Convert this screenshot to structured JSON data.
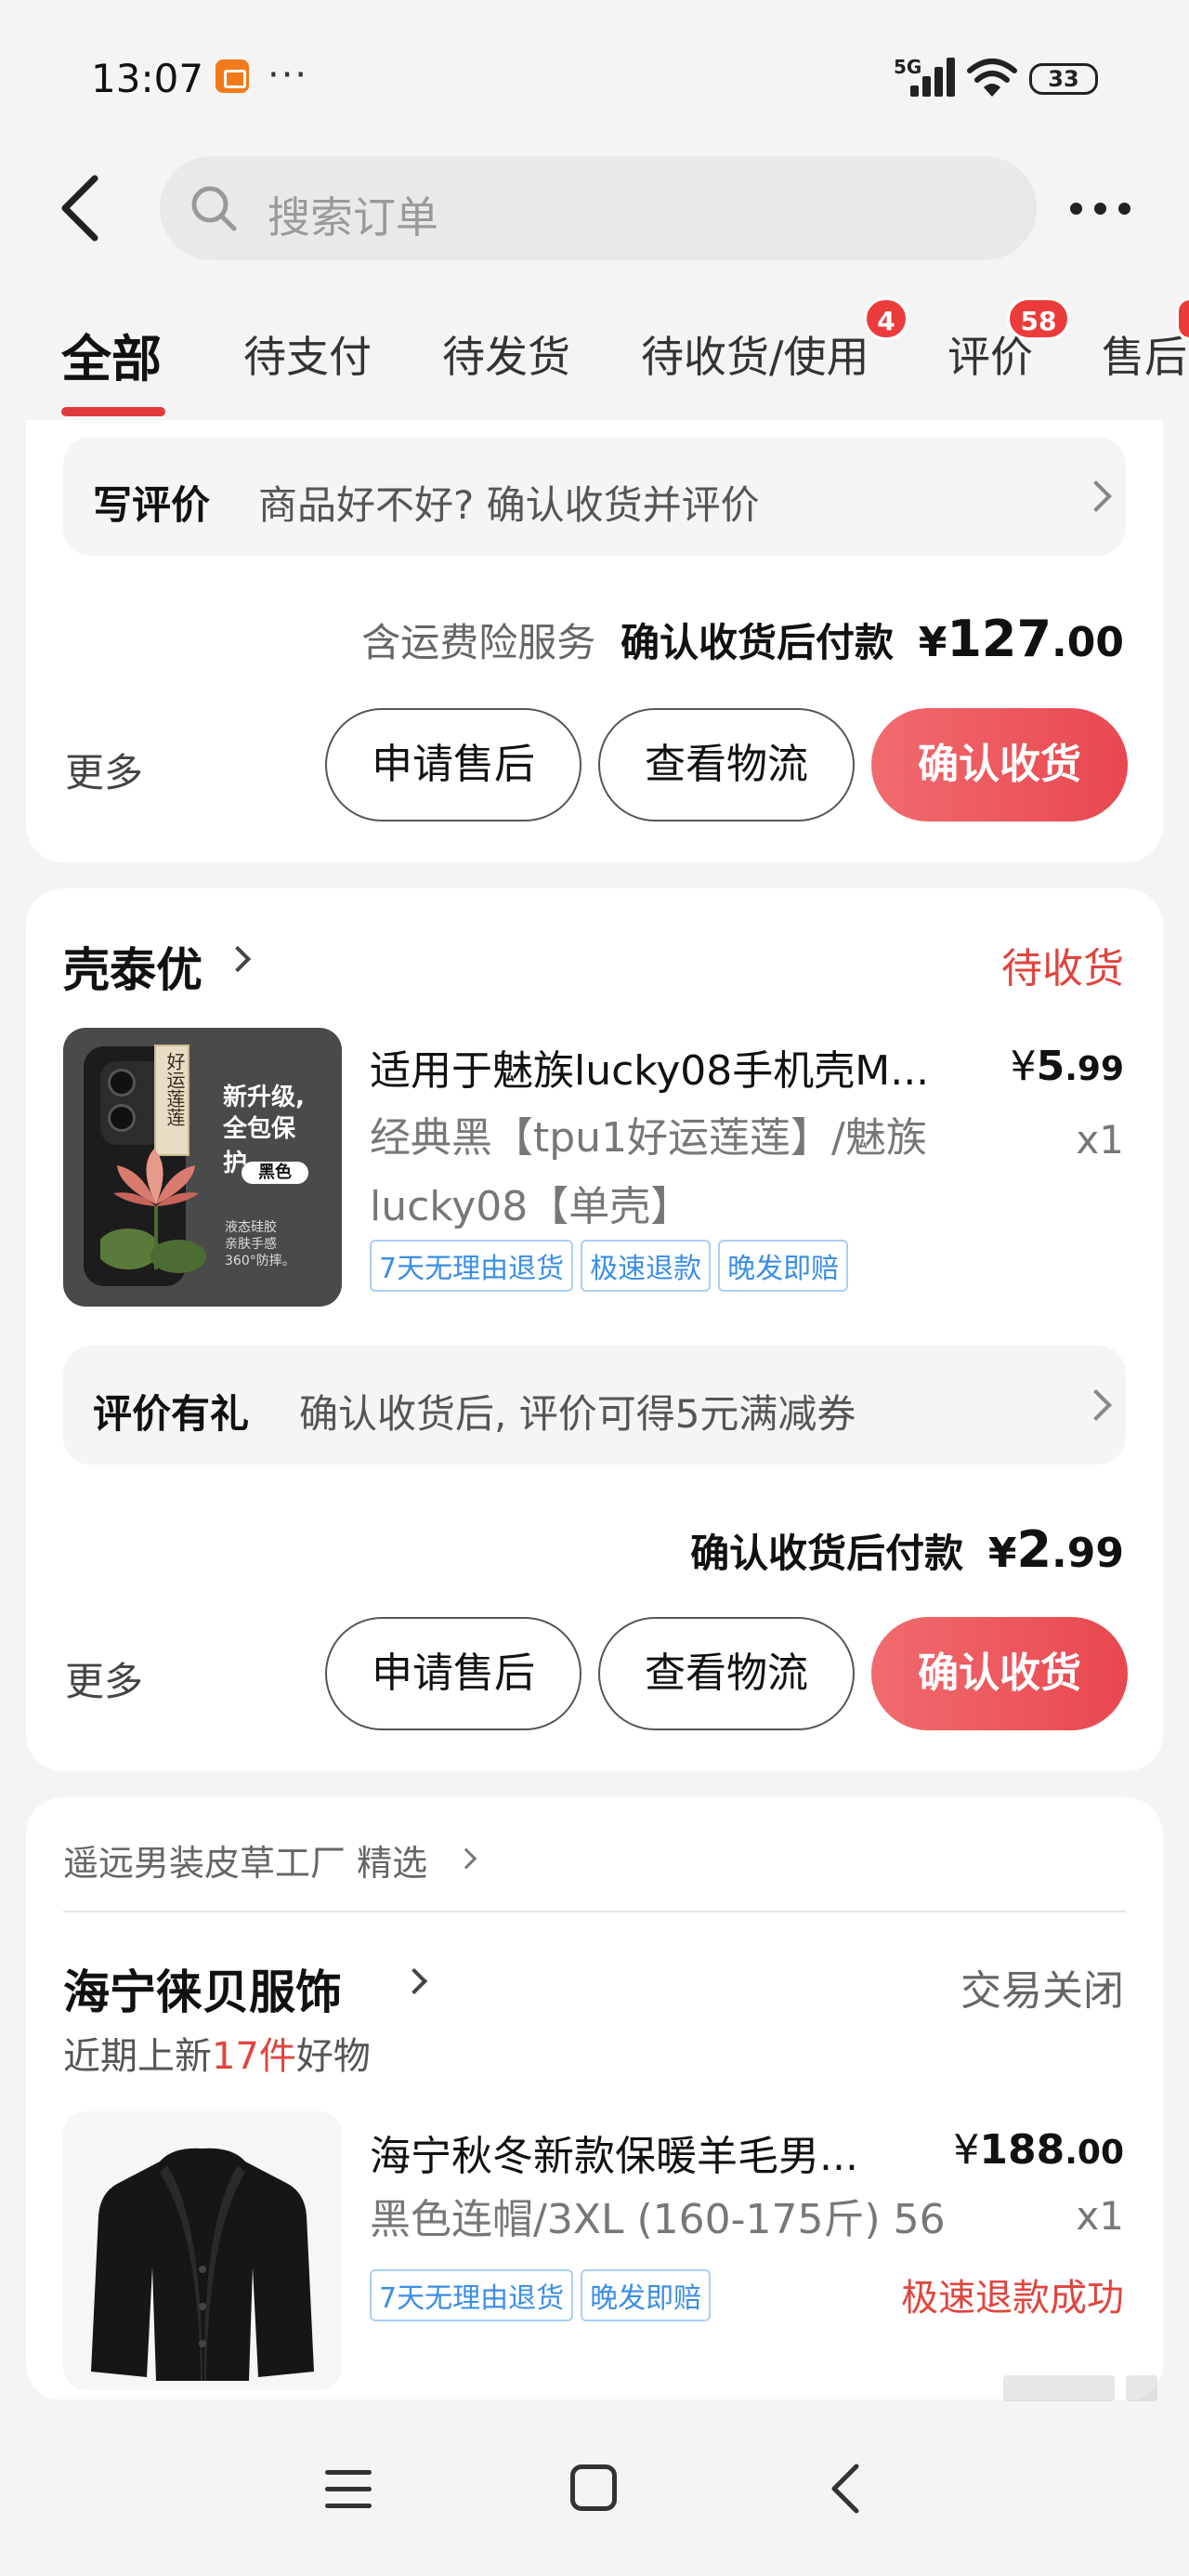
{
  "status_bar": {
    "time": "13:07",
    "dots": "···",
    "network": "5G",
    "battery": "33"
  },
  "search": {
    "placeholder": "搜索订单"
  },
  "tabs": [
    {
      "label": "全部"
    },
    {
      "label": "待支付"
    },
    {
      "label": "待发货"
    },
    {
      "label": "待收货/使用",
      "badge": "4"
    },
    {
      "label": "评价",
      "badge": "58"
    },
    {
      "label": "售后"
    }
  ],
  "order1": {
    "review_label": "写评价",
    "review_text": "商品好不好? 确认收货并评价",
    "pay_prefix": "含运费险服务",
    "pay_label": "确认收货后付款",
    "pay_currency": "¥",
    "pay_int": "127",
    "pay_dec": ".00",
    "more": "更多",
    "btn_after_sale": "申请售后",
    "btn_logistics": "查看物流",
    "btn_confirm": "确认收货"
  },
  "order2": {
    "shop": "壳泰优",
    "status": "待收货",
    "status_color": "#e0453e",
    "product_title": "适用于魅族lucky08手机壳M...",
    "price_currency": "¥",
    "price_int": "5",
    "price_dec": ".99",
    "spec_line1": "经典黑【tpu1好运莲莲】/魅族",
    "spec_line2": "lucky08【单壳】",
    "qty": "x1",
    "tags": [
      "7天无理由退货",
      "极速退款",
      "晚发即赔"
    ],
    "thumb_text": {
      "line1": "新升级,",
      "line2": "全包保护。",
      "color_tag": "黑色",
      "vertical": "好运莲莲",
      "small1": "液态硅胶",
      "small2": "亲肤手感",
      "small3": "360°防摔。"
    },
    "review_label": "评价有礼",
    "review_text": "确认收货后, 评价可得5元满减券",
    "pay_label": "确认收货后付款",
    "pay_currency": "¥",
    "pay_int": "2",
    "pay_dec": ".99",
    "more": "更多",
    "btn_after_sale": "申请售后",
    "btn_logistics": "查看物流",
    "btn_confirm": "确认收货"
  },
  "order3": {
    "recommend": "遥远男装皮草工厂 精选",
    "shop": "海宁徕贝服饰",
    "status": "交易关闭",
    "status_color": "#666666",
    "sub_prefix": "近期上新",
    "sub_count": "17件",
    "sub_suffix": "好物",
    "product_title": "海宁秋冬新款保暖羊毛男...",
    "price_currency": "¥",
    "price_int": "188",
    "price_dec": ".00",
    "spec": "黑色连帽/3XL (160-175斤) 56",
    "qty": "x1",
    "tags": [
      "7天无理由退货",
      "晚发即赔"
    ],
    "refund_status": "极速退款成功"
  },
  "colors": {
    "accent": "#e9474f",
    "tag_blue": "#3a8ee6"
  }
}
